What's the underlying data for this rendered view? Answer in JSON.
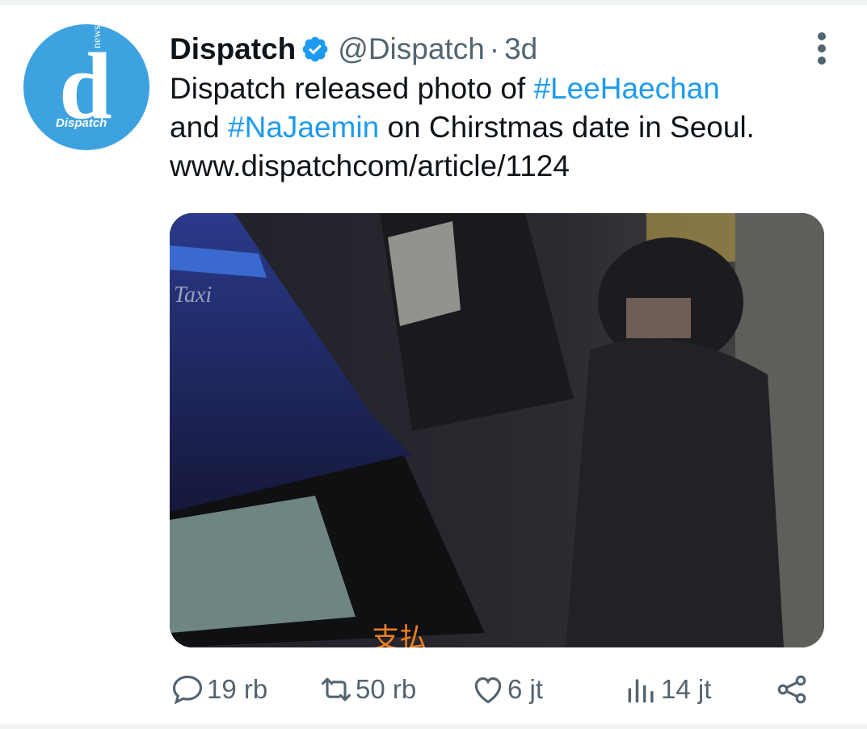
{
  "tweet": {
    "display_name": "Dispatch",
    "handle": "@Dispatch",
    "separator": "·",
    "time": "3d",
    "avatar": {
      "letter": "d",
      "side_text": "news",
      "brand_text": "Dispatch",
      "bg_color": "#3da3e0"
    },
    "text_parts": {
      "line1_prefix": "Dispatch released photo of ",
      "hashtag1": "#LeeHaechan",
      "line2_prefix": "and ",
      "hashtag2": "#NaJaemin",
      "line2_suffix": " on Chirstmas date in Seoul.",
      "link": "www.dispatchcom/article/1124"
    },
    "media": {
      "taxi_text": "Taxi",
      "sign_text": "支払"
    },
    "actions": {
      "reply": {
        "icon": "reply-icon",
        "count": "19 rb"
      },
      "retweet": {
        "icon": "retweet-icon",
        "count": "50 rb"
      },
      "like": {
        "icon": "heart-icon",
        "count": "6 jt"
      },
      "views": {
        "icon": "views-icon",
        "count": "14 jt"
      },
      "share": {
        "icon": "share-icon"
      }
    }
  },
  "colors": {
    "accent": "#1d9bf0",
    "secondary": "#536471",
    "text": "#0f1419"
  }
}
